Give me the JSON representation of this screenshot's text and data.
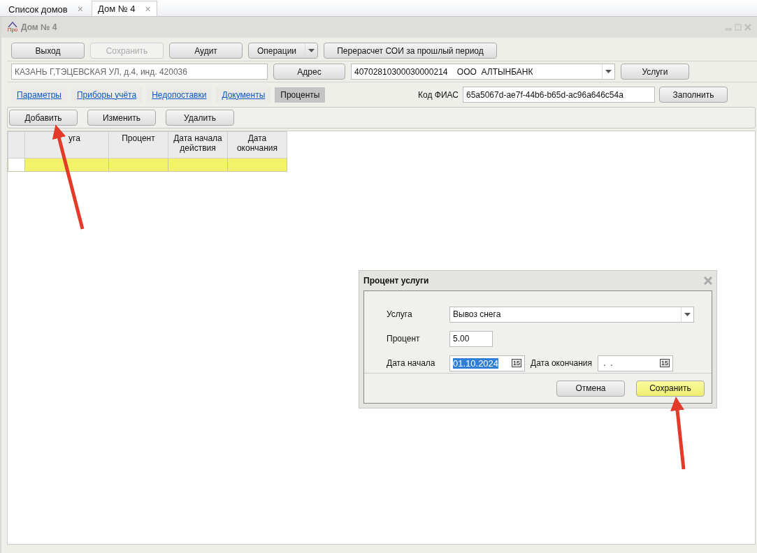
{
  "doc_tabs": [
    {
      "label": "Список домов",
      "close": "×",
      "selected": false
    },
    {
      "label": "Дом № 4",
      "close": "×",
      "selected": true
    }
  ],
  "window": {
    "logo_text": "Про",
    "title": "Дом № 4"
  },
  "toolbar": [
    {
      "label": "Выход",
      "disabled": false,
      "kind": "button"
    },
    {
      "label": "Сохранить",
      "disabled": true,
      "kind": "button"
    },
    {
      "label": "Аудит",
      "disabled": false,
      "kind": "button"
    },
    {
      "label": "Операции",
      "disabled": false,
      "kind": "split"
    },
    {
      "label": "Перерасчет СОИ за прошлый период",
      "disabled": false,
      "kind": "button"
    }
  ],
  "address": {
    "value": "КАЗАНЬ Г,ТЭЦЕВСКАЯ УЛ, д.4, инд. 420036",
    "button": "Адрес"
  },
  "account": {
    "value": "40702810300030000214    ООО  АЛТЫНБАНК",
    "button": "Услуги"
  },
  "sections": [
    {
      "label": "Параметры",
      "selected": false
    },
    {
      "label": "Приборы учёта",
      "selected": false
    },
    {
      "label": "Недопоставки",
      "selected": false
    },
    {
      "label": "Документы",
      "selected": false
    },
    {
      "label": "Проценты",
      "selected": true
    }
  ],
  "fias": {
    "label": "Код ФИАС",
    "value": "65a5067d-ae7f-44b6-b65d-ac96a646c54a",
    "button": "Заполнить"
  },
  "grid_toolbar": [
    "Добавить",
    "Изменить",
    "Удалить"
  ],
  "table": {
    "columns": [
      "уга",
      "Процент",
      "Дата начала действия",
      "Дата окончания"
    ],
    "rows": [
      {
        "selected": true
      }
    ]
  },
  "dialog": {
    "title": "Процент услуги",
    "service": {
      "label": "Услуга",
      "value": "Вывоз снега"
    },
    "percent": {
      "label": "Процент",
      "value": "5.00"
    },
    "start": {
      "label": "Дата начала",
      "value": "01.10.2024",
      "calendar": "15"
    },
    "end": {
      "label": "Дата окончания",
      "value": " .  .",
      "calendar": "15"
    },
    "buttons": [
      {
        "label": "Отмена",
        "kind": "normal"
      },
      {
        "label": "Сохранить",
        "kind": "primary"
      }
    ]
  }
}
